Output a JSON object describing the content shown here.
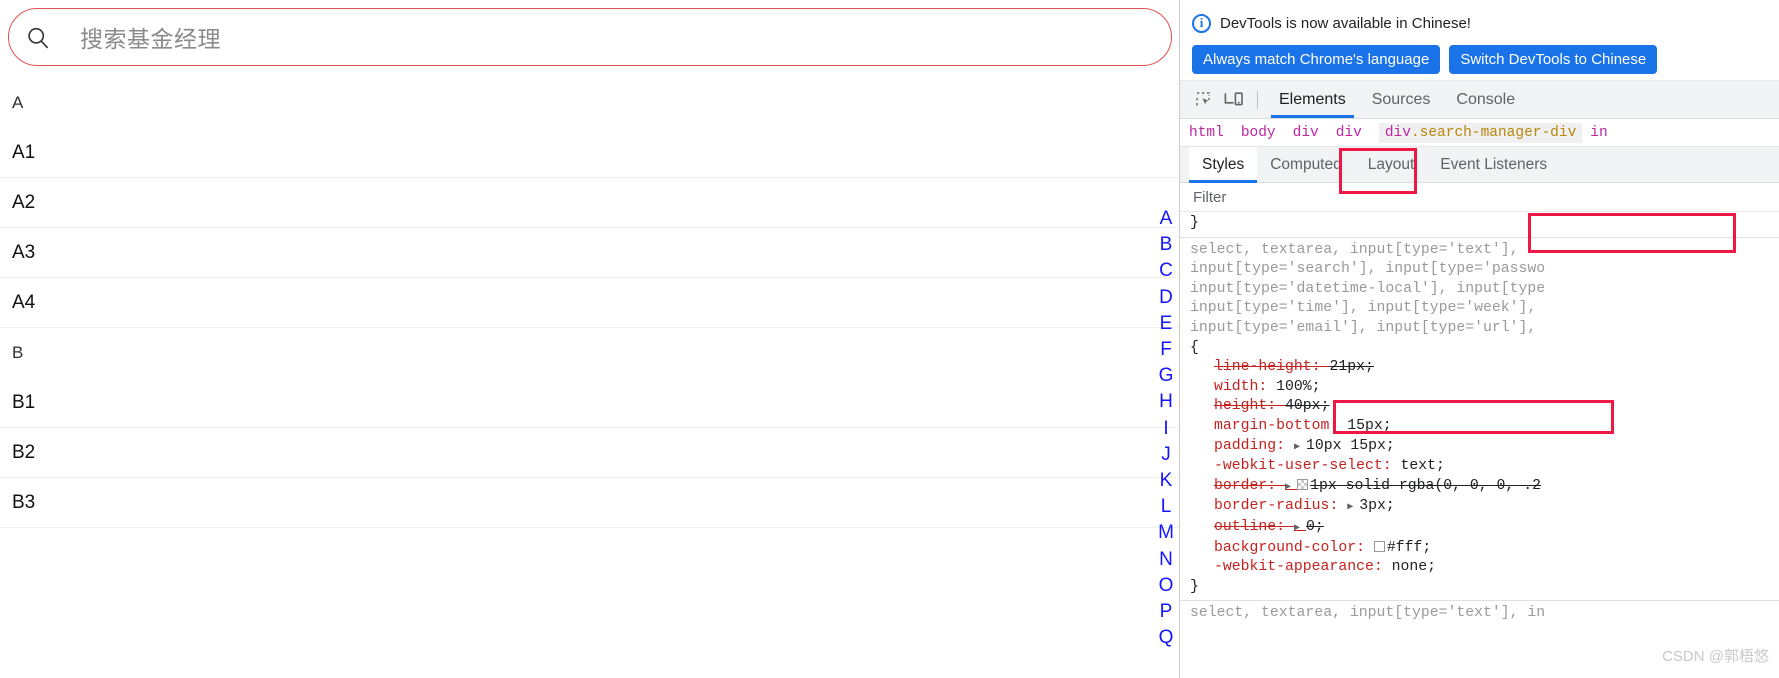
{
  "search": {
    "placeholder": "搜索基金经理",
    "icon": "search-icon",
    "value": ""
  },
  "list": [
    {
      "label": "A",
      "type": "section"
    },
    {
      "label": "A1",
      "type": "item"
    },
    {
      "label": "A2",
      "type": "item"
    },
    {
      "label": "A3",
      "type": "item"
    },
    {
      "label": "A4",
      "type": "item"
    },
    {
      "label": "B",
      "type": "section"
    },
    {
      "label": "B1",
      "type": "item"
    },
    {
      "label": "B2",
      "type": "item"
    },
    {
      "label": "B3",
      "type": "item"
    }
  ],
  "alpha_index": [
    "A",
    "B",
    "C",
    "D",
    "E",
    "F",
    "G",
    "H",
    "I",
    "J",
    "K",
    "L",
    "M",
    "N",
    "O",
    "P",
    "Q"
  ],
  "devtools": {
    "banner": {
      "icon": "info-icon",
      "glyph": "i",
      "text": "DevTools is now available in Chinese!",
      "buttons": [
        "Always match Chrome's language",
        "Switch DevTools to Chinese"
      ]
    },
    "toolbar": {
      "inspect_icon": "inspect-element-icon",
      "device_icon": "device-toolbar-icon",
      "tabs": [
        {
          "label": "Elements",
          "active": true
        },
        {
          "label": "Sources",
          "active": false
        },
        {
          "label": "Console",
          "active": false
        }
      ]
    },
    "breadcrumb": [
      {
        "text": "html",
        "class_part": ""
      },
      {
        "text": "body",
        "class_part": ""
      },
      {
        "text": "div",
        "class_part": ""
      },
      {
        "text": "div",
        "class_part": ""
      },
      {
        "text": "div",
        "class_part": ".search-manager-div"
      },
      {
        "text": "in",
        "class_part": ""
      }
    ],
    "sidebar_tabs": [
      {
        "label": "Styles",
        "active": true
      },
      {
        "label": "Computed",
        "active": false
      },
      {
        "label": "Layout",
        "active": false
      },
      {
        "label": "Event Listeners",
        "active": false
      }
    ],
    "filter_placeholder": "Filter",
    "styles": {
      "prev_rule_close": "}",
      "selector_lines": [
        "select, textarea, input[type='text'],",
        "input[type='search'], input[type='passwo",
        "input[type='datetime-local'], input[type",
        "input[type='time'], input[type='week'],",
        "input[type='email'], input[type='url'],"
      ],
      "open_brace": "{",
      "declarations": [
        {
          "name": "line-height",
          "value": "21px;",
          "strike": true,
          "arrow": false,
          "swatch": ""
        },
        {
          "name": "width",
          "value": "100%;",
          "strike": false,
          "arrow": false,
          "swatch": ""
        },
        {
          "name": "height",
          "value": "40px;",
          "strike": true,
          "arrow": false,
          "swatch": ""
        },
        {
          "name": "margin-bottom",
          "value": "15px;",
          "strike": false,
          "arrow": false,
          "swatch": ""
        },
        {
          "name": "padding",
          "value": "10px 15px;",
          "strike": false,
          "arrow": true,
          "swatch": ""
        },
        {
          "name": "-webkit-user-select",
          "value": "text;",
          "strike": false,
          "arrow": false,
          "swatch": ""
        },
        {
          "name": "border",
          "value": "1px solid rgba(0, 0, 0, .2",
          "strike": true,
          "arrow": true,
          "swatch": "checker"
        },
        {
          "name": "border-radius",
          "value": "3px;",
          "strike": false,
          "arrow": true,
          "swatch": ""
        },
        {
          "name": "outline",
          "value": "0;",
          "strike": true,
          "arrow": true,
          "swatch": ""
        },
        {
          "name": "background-color",
          "value": "#fff;",
          "strike": false,
          "arrow": false,
          "swatch": "white"
        },
        {
          "name": "-webkit-appearance",
          "value": "none;",
          "strike": false,
          "arrow": false,
          "swatch": ""
        }
      ],
      "close_brace": "}",
      "next_rule": "select, textarea, input[type='text'], in"
    }
  },
  "watermark": "CSDN @郭梧悠",
  "colors": {
    "accent_blue": "#1a73e8",
    "annotation_red": "#ed1846",
    "search_border": "#e05252",
    "index_blue": "#1414ff",
    "css_prop_red": "#c5221f"
  }
}
